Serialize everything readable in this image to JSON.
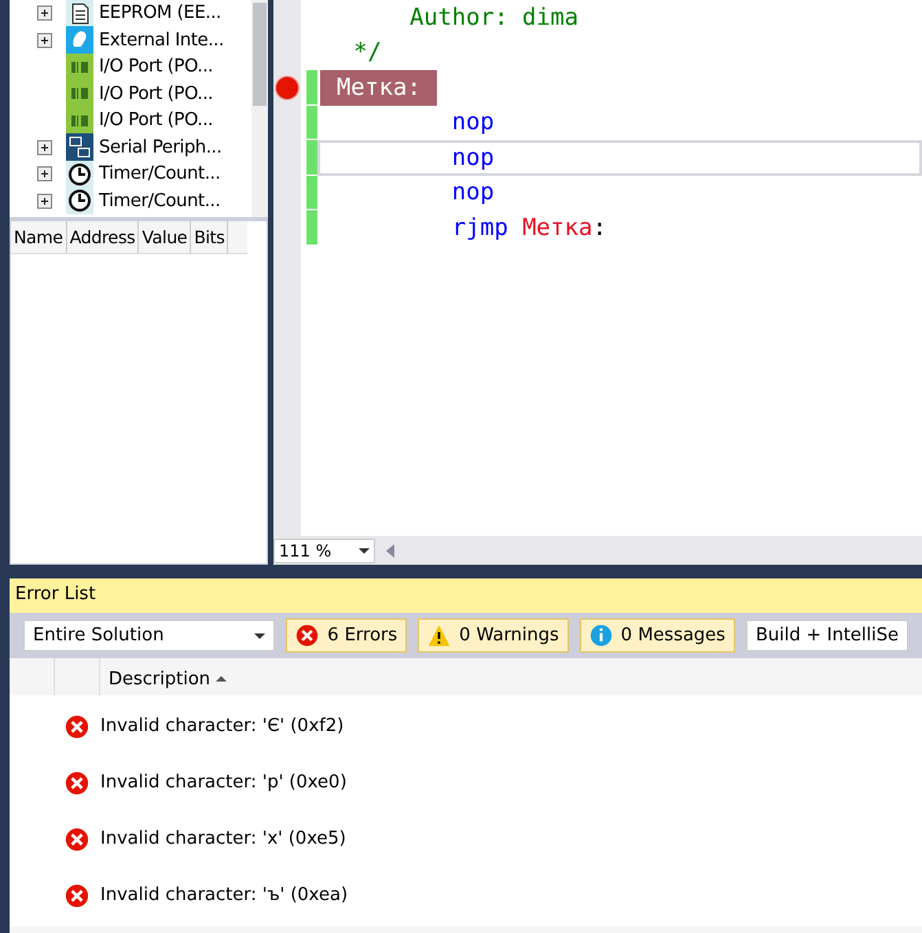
{
  "tree": {
    "items": [
      {
        "kind": "eeprom",
        "label": "EEPROM (EE...",
        "expandable": true
      },
      {
        "kind": "interrupt",
        "label": "External Inte...",
        "expandable": true
      },
      {
        "kind": "io",
        "label": "I/O Port (PO...",
        "expandable": false
      },
      {
        "kind": "io",
        "label": "I/O Port (PO...",
        "expandable": false
      },
      {
        "kind": "io",
        "label": "I/O Port (PO...",
        "expandable": false
      },
      {
        "kind": "serial",
        "label": "Serial Periph...",
        "expandable": true
      },
      {
        "kind": "timer",
        "label": "Timer/Count...",
        "expandable": true
      },
      {
        "kind": "timer",
        "label": "Timer/Count...",
        "expandable": true
      }
    ]
  },
  "registers": {
    "columns": [
      "Name",
      "Address",
      "Value",
      "Bits"
    ]
  },
  "editor": {
    "lines": [
      {
        "kind": "comment-body",
        "tokens": [
          {
            "kind": "comment",
            "text": "Author: dima"
          }
        ],
        "breakpoint": false,
        "changed": false,
        "current": false
      },
      {
        "kind": "comment-end",
        "tokens": [
          {
            "kind": "comment",
            "text": "*/"
          }
        ],
        "breakpoint": false,
        "changed": false,
        "current": false
      },
      {
        "kind": "label",
        "tokens": [
          {
            "kind": "label-hl",
            "text": "Метка:"
          }
        ],
        "breakpoint": true,
        "changed": true,
        "current": false
      },
      {
        "kind": "instruction",
        "tokens": [
          {
            "kind": "keyword",
            "text": "nop"
          }
        ],
        "breakpoint": false,
        "changed": true,
        "current": false
      },
      {
        "kind": "instruction",
        "tokens": [
          {
            "kind": "keyword",
            "text": "nop"
          }
        ],
        "breakpoint": false,
        "changed": true,
        "current": true
      },
      {
        "kind": "instruction",
        "tokens": [
          {
            "kind": "keyword",
            "text": "nop"
          }
        ],
        "breakpoint": false,
        "changed": true,
        "current": false
      },
      {
        "kind": "instruction",
        "tokens": [
          {
            "kind": "keyword",
            "text": "rjmp"
          },
          {
            "kind": "label-ref",
            "text": "Метка"
          },
          {
            "kind": "plain",
            "text": ":"
          }
        ],
        "breakpoint": false,
        "changed": true,
        "current": false
      }
    ],
    "zoom": "111 %"
  },
  "error_list": {
    "title": "Error List",
    "scope": "Entire Solution",
    "filters": [
      {
        "kind": "error",
        "label": "6 Errors",
        "selected": true
      },
      {
        "kind": "warning",
        "label": "0 Warnings",
        "selected": true
      },
      {
        "kind": "info",
        "label": "0 Messages",
        "selected": true
      }
    ],
    "source": "Build + IntelliSe",
    "column": "Description",
    "rows": [
      {
        "kind": "error",
        "text": "Invalid character: 'Є' (0xf2)"
      },
      {
        "kind": "error",
        "text": "Invalid character: 'р' (0xe0)"
      },
      {
        "kind": "error",
        "text": "Invalid character: 'х' (0xe5)"
      },
      {
        "kind": "error",
        "text": "Invalid character: 'ъ' (0xea)"
      }
    ]
  }
}
